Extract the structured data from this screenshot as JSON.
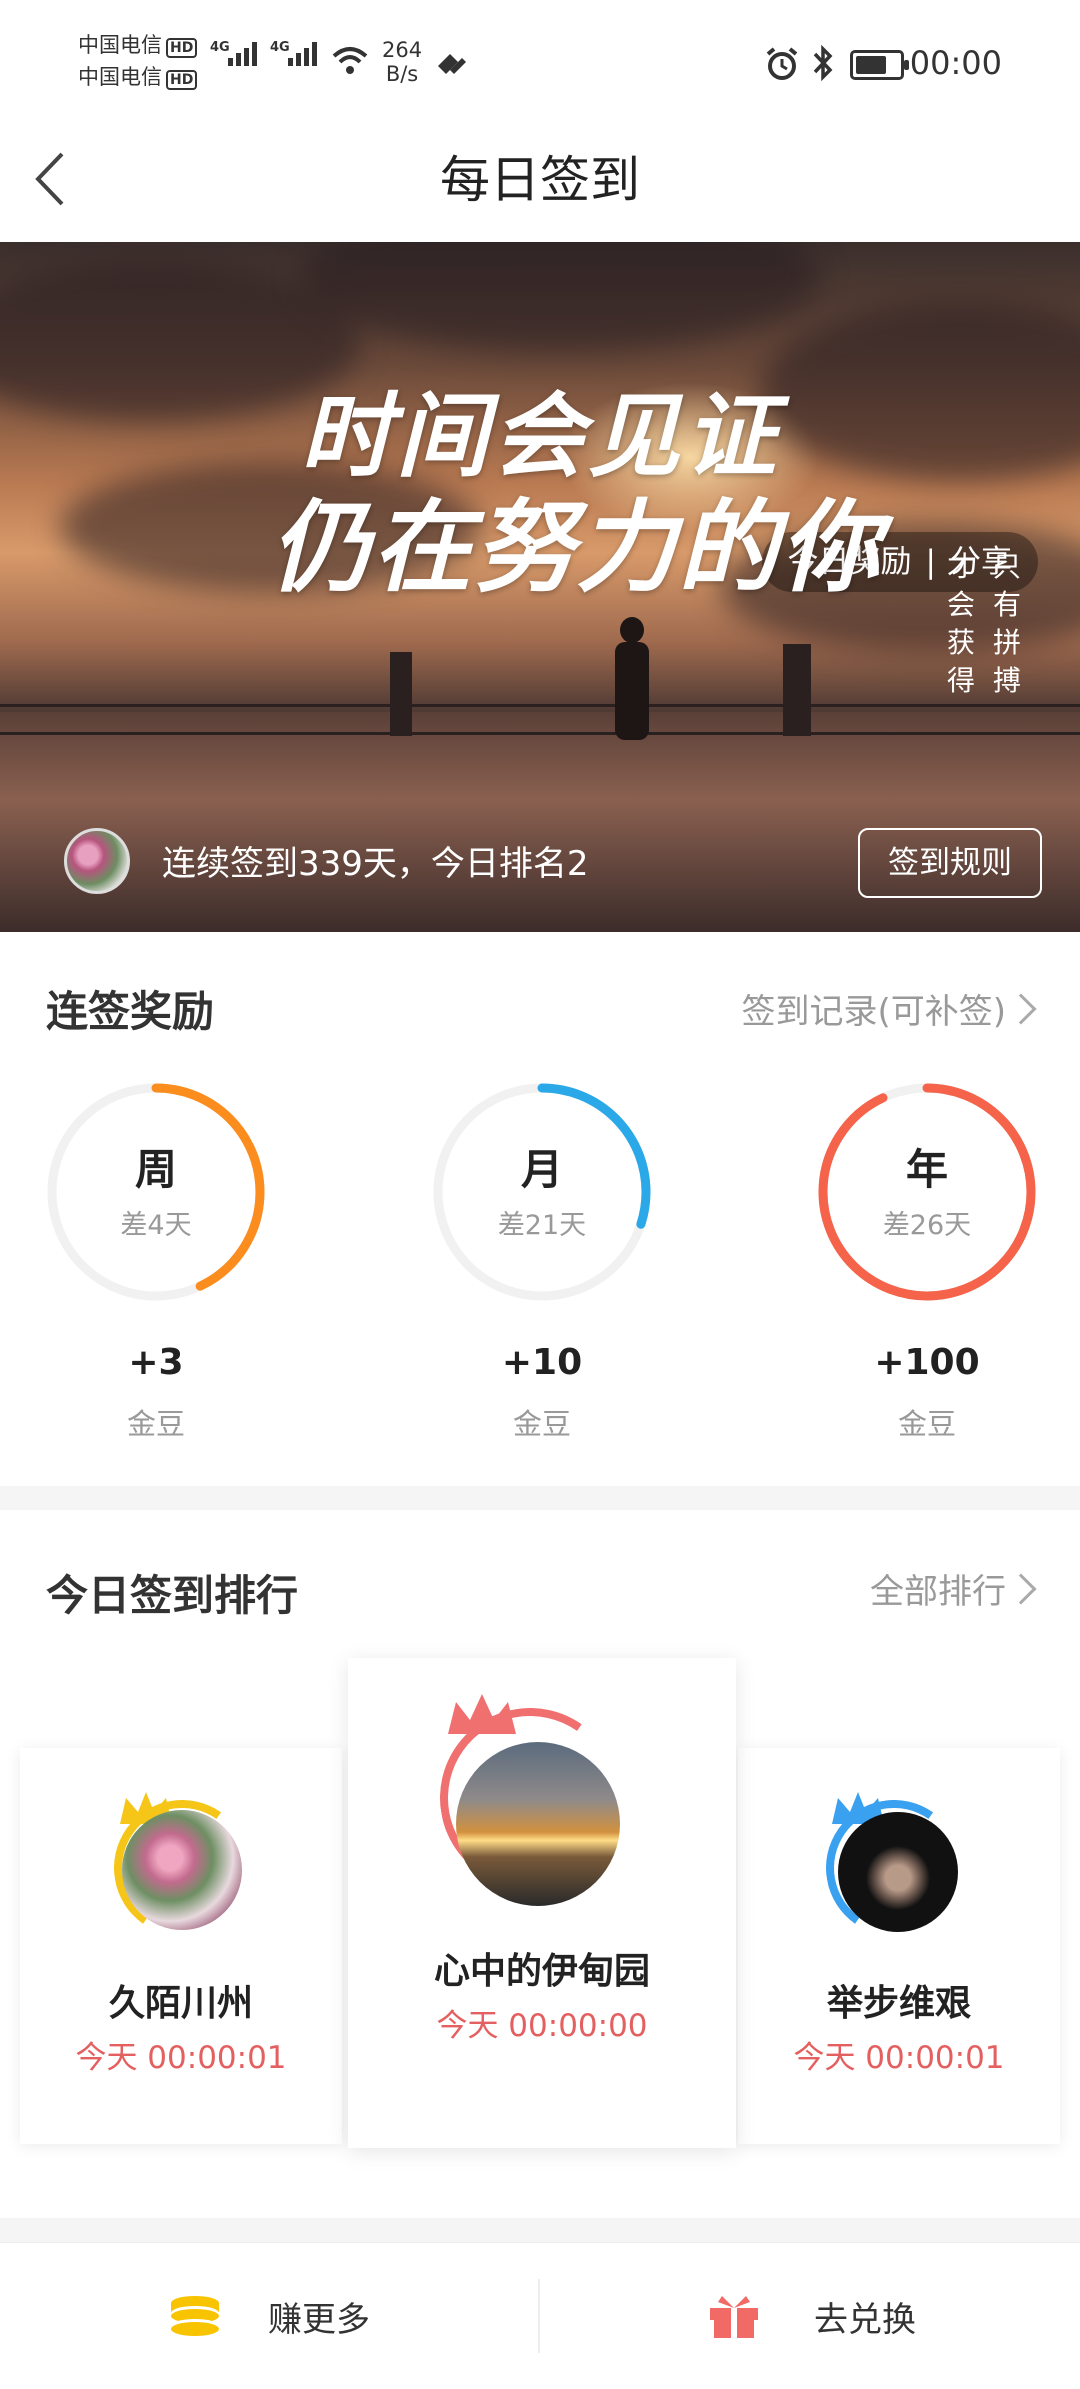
{
  "status_bar": {
    "carrier1": "中国电信",
    "carrier2": "中国电信",
    "hd": "HD",
    "net1": "4G",
    "net2": "4G",
    "speed_value": "264",
    "speed_unit": "B/s",
    "time": "00:00"
  },
  "nav": {
    "title": "每日签到"
  },
  "banner": {
    "today_reward": "今日奖励",
    "separator": "|",
    "share": "分享",
    "slogan_line1": "时间会见证",
    "slogan_line2": "仍在努力的你",
    "vertical_col1": "只有拼搏",
    "vertical_col2": "才会获得",
    "streak_text": "连续签到339天，今日排名2",
    "rules_button": "签到规则"
  },
  "rewards": {
    "title": "连签奖励",
    "link": "签到记录(可补签)",
    "items": [
      {
        "label": "周",
        "remaining": "差4天",
        "bonus": "+3",
        "unit": "金豆",
        "progress": 0.43,
        "color": "#fb8c1e"
      },
      {
        "label": "月",
        "remaining": "差21天",
        "bonus": "+10",
        "unit": "金豆",
        "progress": 0.3,
        "color": "#2aa8e8"
      },
      {
        "label": "年",
        "remaining": "差26天",
        "bonus": "+100",
        "unit": "金豆",
        "progress": 0.93,
        "color": "#f4634a"
      }
    ]
  },
  "ranking": {
    "title": "今日签到排行",
    "link": "全部排行",
    "entries": [
      {
        "rank": 2,
        "name": "久陌川州",
        "time": "今天 00:00:01",
        "crown_color": "#f5c518"
      },
      {
        "rank": 1,
        "name": "心中的伊甸园",
        "time": "今天 00:00:00",
        "crown_color": "#f07070"
      },
      {
        "rank": 3,
        "name": "举步维艰",
        "time": "今天 00:00:01",
        "crown_color": "#3aa0f0"
      }
    ]
  },
  "bottom_bar": {
    "earn": "赚更多",
    "redeem": "去兑换",
    "earn_icon": "coin-stack-icon",
    "redeem_icon": "gift-icon"
  }
}
